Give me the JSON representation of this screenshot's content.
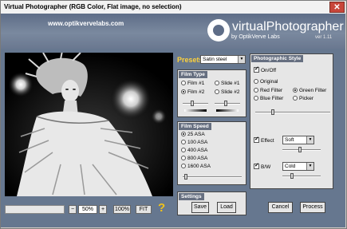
{
  "window": {
    "title": "Virtual Photographer (RGB Color, Flat image, no selection)",
    "close_glyph": "✕"
  },
  "header": {
    "url": "www.optikvervelabs.com",
    "logo_text": "virtualPhotographer",
    "logo_sub": "by OptikVerve Labs",
    "version": "ver 1.11"
  },
  "zoom": {
    "minus_label": "−",
    "value": "50%",
    "plus_label": "+",
    "fit100_label": "100%",
    "fit_label": "FIT",
    "help_label": "?"
  },
  "presets": {
    "label": "Presets",
    "value": "Satin steel"
  },
  "film_type": {
    "title": "Film Type",
    "options": [
      "Film #1",
      "Slide #1",
      "Film #2",
      "Slide #2"
    ],
    "selected": "Film #2"
  },
  "film_speed": {
    "title": "Film Speed",
    "options": [
      "25 ASA",
      "100 ASA",
      "400 ASA",
      "800 ASA",
      "1600 ASA"
    ],
    "selected": "25 ASA"
  },
  "photo_style": {
    "title": "Photographic Style",
    "onoff_label": "On/Off",
    "options": [
      "Original",
      "Red Filter",
      "Green Filter",
      "Blue Filter",
      "Picker"
    ],
    "selected": "Green Filter",
    "effect_label": "Effect",
    "effect_value": "Soft",
    "bw_label": "B/W",
    "bw_value": "Cold"
  },
  "settings": {
    "title": "Settings",
    "save_label": "Save",
    "load_label": "Load"
  },
  "actions": {
    "cancel_label": "Cancel",
    "process_label": "Process"
  },
  "colors": {
    "header_bg": "#5e6d87",
    "body_bg": "#66778f",
    "panel_title_bg": "#666f80",
    "presets_label": "#ffd23a",
    "help_icon": "#f0c21a",
    "close_button": "#c8463a"
  }
}
